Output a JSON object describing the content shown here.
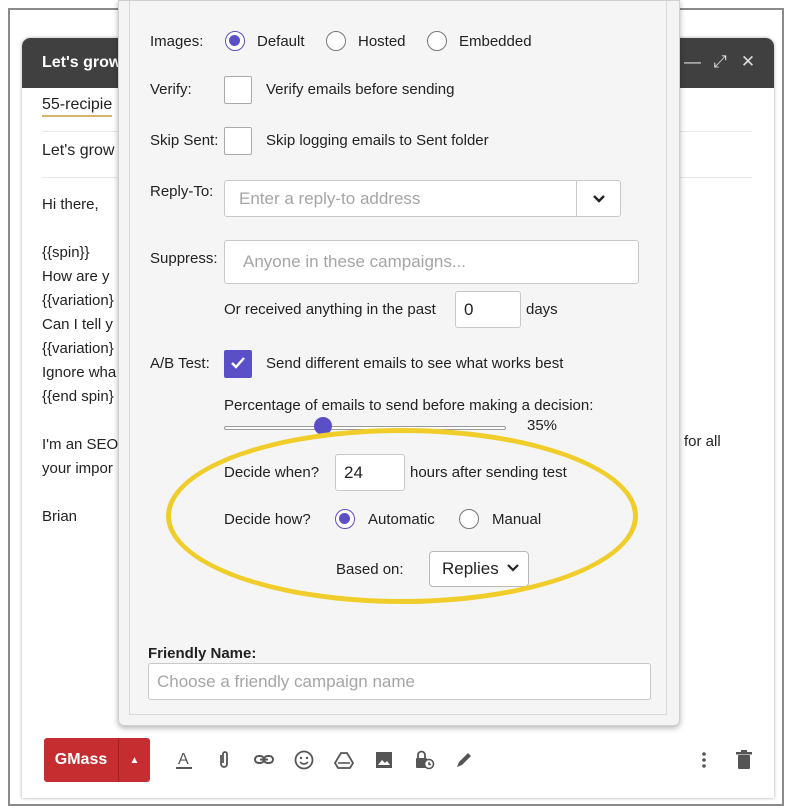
{
  "compose": {
    "title": "Let's grow",
    "recipients": "55-recipie",
    "subject": "Let's grow",
    "body_lines": [
      "Hi there,",
      "",
      "{{spin}}",
      "How are y",
      "{{variation}",
      "Can I tell y",
      "{{variation}",
      "Ignore wha",
      "{{end spin}",
      "",
      "I'm an SEO",
      "your impor",
      "",
      "Brian"
    ],
    "body_right_lines": [
      "for all"
    ]
  },
  "toolbar": {
    "send_label": "GMass",
    "icons": [
      "format-text-icon",
      "attach-icon",
      "link-icon",
      "emoji-icon",
      "drive-icon",
      "image-icon",
      "confidential-icon",
      "signature-icon",
      "more-options-icon",
      "trash-icon"
    ]
  },
  "settings": {
    "images": {
      "label": "Images:",
      "options": [
        "Default",
        "Hosted",
        "Embedded"
      ],
      "selected": "Default"
    },
    "verify": {
      "label": "Verify:",
      "text": "Verify emails before sending",
      "checked": false
    },
    "skip_sent": {
      "label": "Skip Sent:",
      "text": "Skip logging emails to Sent folder",
      "checked": false
    },
    "reply_to": {
      "label": "Reply-To:",
      "placeholder": "Enter a reply-to address"
    },
    "suppress": {
      "label": "Suppress:",
      "placeholder": "Anyone in these campaigns...",
      "past_prefix": "Or received anything in the past",
      "past_value": "0",
      "past_suffix": "days"
    },
    "ab_test": {
      "label": "A/B Test:",
      "text": "Send different emails to see what works best",
      "checked": true,
      "percentage_label": "Percentage of emails to send before making a decision:",
      "percentage_value": 35,
      "percentage_display": "35%",
      "decide_when_label": "Decide when?",
      "decide_when_value": "24",
      "decide_when_suffix": "hours after sending test",
      "decide_how_label": "Decide how?",
      "decide_how_options": [
        "Automatic",
        "Manual"
      ],
      "decide_how_selected": "Automatic",
      "based_on_label": "Based on:",
      "based_on_value": "Replies"
    },
    "friendly_name": {
      "label": "Friendly Name:",
      "placeholder": "Choose a friendly campaign name"
    }
  },
  "colors": {
    "accent": "#5b4fc7",
    "gmass_red": "#c62d31",
    "highlight": "#f1cd2b",
    "header_bg": "#404040"
  }
}
